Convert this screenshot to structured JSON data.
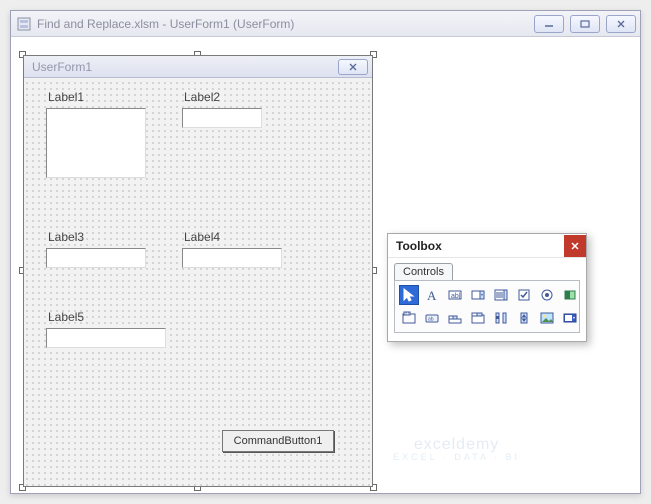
{
  "window": {
    "title": "Find and Replace.xlsm - UserForm1 (UserForm)"
  },
  "userform": {
    "title": "UserForm1",
    "labels": {
      "label1": "Label1",
      "label2": "Label2",
      "label3": "Label3",
      "label4": "Label4",
      "label5": "Label5"
    },
    "button1": "CommandButton1"
  },
  "toolbox": {
    "title": "Toolbox",
    "tab": "Controls",
    "tools_row1": [
      "select",
      "label",
      "textbox",
      "combobox",
      "listbox",
      "checkbox",
      "optionbutton",
      "togglebutton"
    ],
    "tools_row2": [
      "frame",
      "commandbutton",
      "tabstrip",
      "multipage",
      "scrollbar",
      "spinbutton",
      "image",
      "refedit"
    ]
  },
  "watermark": {
    "main": "exceldemy",
    "sub": "EXCEL · DATA · BI"
  }
}
